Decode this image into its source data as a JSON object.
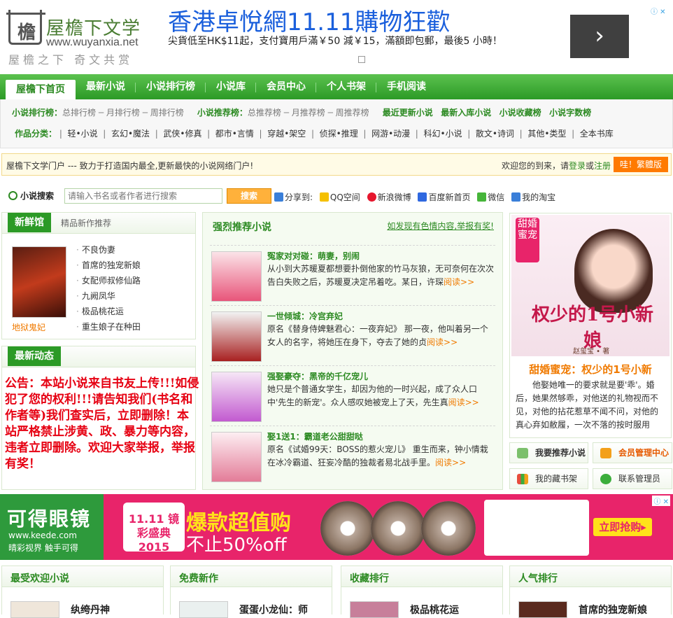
{
  "logo": {
    "name": "屋檐下文学",
    "url": "www.wuyanxia.net",
    "slogan": "屋檐之下 奇文共赏",
    "mark": "檐"
  },
  "ad_top": {
    "title": "香港卓悅網11.11購物狂歡",
    "text": "尖貨低至HK$11起，支付寶用戶滿￥50 減￥15，滿額即包郵，最後5 小時！",
    "next": "›",
    "controls": "ⓘ ✕"
  },
  "nav": {
    "items": [
      "屋檐下首页",
      "最新小说",
      "小说排行榜",
      "小说库",
      "会员中心",
      "个人书架",
      "手机阅读"
    ]
  },
  "subnav": {
    "rank_label": "小说排行榜：",
    "rank_items": [
      "总排行榜",
      "月排行榜",
      "周排行榜"
    ],
    "rec_label": "小说推荐榜：",
    "rec_items": [
      "总推荐榜",
      "月推荐榜",
      "周推荐榜"
    ],
    "extra": [
      "最近更新小说",
      "最新入库小说",
      "小说收藏榜",
      "小说字数榜"
    ],
    "cat_label": "作品分类：",
    "cats": [
      "轻•小说",
      "玄幻•魔法",
      "武侠•修真",
      "都市•言情",
      "穿越•架空",
      "侦探•推理",
      "网游•动漫",
      "科幻•小说",
      "散文•诗词",
      "其他•类型",
      "全本书库"
    ]
  },
  "infobar": {
    "left": "屋檐下文学门户 --- 致力于打造国内最全,更新最快的小说网络门户!",
    "welcome": "欢迎您的到来，请",
    "login": "登录",
    "or": "或",
    "register": "注册",
    "button": "哇！繁體版"
  },
  "search": {
    "label": "小说搜索",
    "placeholder": "请输入书名或者作者进行搜索",
    "button": "搜索",
    "share_label": "分享到:",
    "share": [
      "QQ空间",
      "新浪微博",
      "百度新首页",
      "微信",
      "我的淘宝"
    ]
  },
  "fresh": {
    "tab": "新鲜馆",
    "tab2": "精品新作推荐",
    "book": "地狱鬼妃",
    "list": [
      "不良伪妻",
      "首席的独宠新娘",
      "女配师叔修仙路",
      "九阙凤华",
      "极品桃花运",
      "重生娘子在种田"
    ]
  },
  "news": {
    "tab": "最新动态",
    "notice": "公告：本站小说来自书友上传!!!如侵犯了您的权利!!!请告知我们(书名和作者等)我们查实后，立即删除！本站严格禁止涉黄、政、暴力等内容，违者立即删除。欢迎大家举报，举报有奖！"
  },
  "recommend": {
    "title": "强烈推荐小说",
    "report": "如发现有色情内容,举报有奖!",
    "items": [
      {
        "title": "冤家对对碰：萌妻，别闹",
        "desc": "从小到大苏暖夏都想要扑倒他家的竹马灰狼，无可奈何在次次告白失败之后，苏暖夏决定吊着吃。某日，许琛",
        "more": "阅读>>"
      },
      {
        "title": "一世倾城：冷宫弃妃",
        "desc": "原名《替身侍婢魅君心：一夜弃妃》 那一夜，他叫着另一个女人的名字，将她压在身下，夺去了她的贞",
        "more": "阅读>>"
      },
      {
        "title": "强娶豪夺：黑帝的千亿宠儿",
        "desc": "她只是个普通女学生，却因为他的一时兴起，成了众人口中'先生的新宠'。众人感叹她被宠上了天，先生真",
        "more": "阅读>>"
      },
      {
        "title": "娶1送1：霸道老公甜甜哒",
        "desc": "原名《试婚99天：BOSS的惹火宠儿》 重生而来，钟小情栽在冰冷霸道、狂妄冷酷的独裁者易北战手里。",
        "more": "阅读>>"
      }
    ]
  },
  "featured": {
    "cover_title": "权少的1号小新娘",
    "badge": "甜婚蜜宠",
    "author": "赵玺宝 • 著",
    "title": "甜婚蜜宠：权少的1号小新",
    "desc": "他娶她唯一的要求就是要'乖'。婚后，她果然够乖，对他送的礼物视而不见，对他的拈花惹草不闻不问，对他的真心弃如敝履，一次不落的按时服用"
  },
  "actions": [
    "我要推荐小说",
    "会员管理中心",
    "我的藏书架",
    "联系管理员"
  ],
  "ad_mid": {
    "brand": "可得眼镜",
    "brand_url": "www.keede.com",
    "brand_slogan": "晴彩视界 触手可得",
    "event": "11.11 镜彩盛典 2015",
    "headline": "爆款超值购",
    "sub": "不止50%off",
    "cta": "立即抢购▸"
  },
  "bottom": [
    {
      "head": "最受欢迎小说",
      "title": "纨绔丹神"
    },
    {
      "head": "免费新作",
      "title": "蛋蛋小龙仙：师"
    },
    {
      "head": "收藏排行",
      "title": "极品桃花运"
    },
    {
      "head": "人气排行",
      "title": "首席的独宠新娘"
    }
  ],
  "colors": {
    "green": "#2c9a26",
    "accent": "#f07a00",
    "alert": "#e60012",
    "ad": "#e8246a"
  }
}
